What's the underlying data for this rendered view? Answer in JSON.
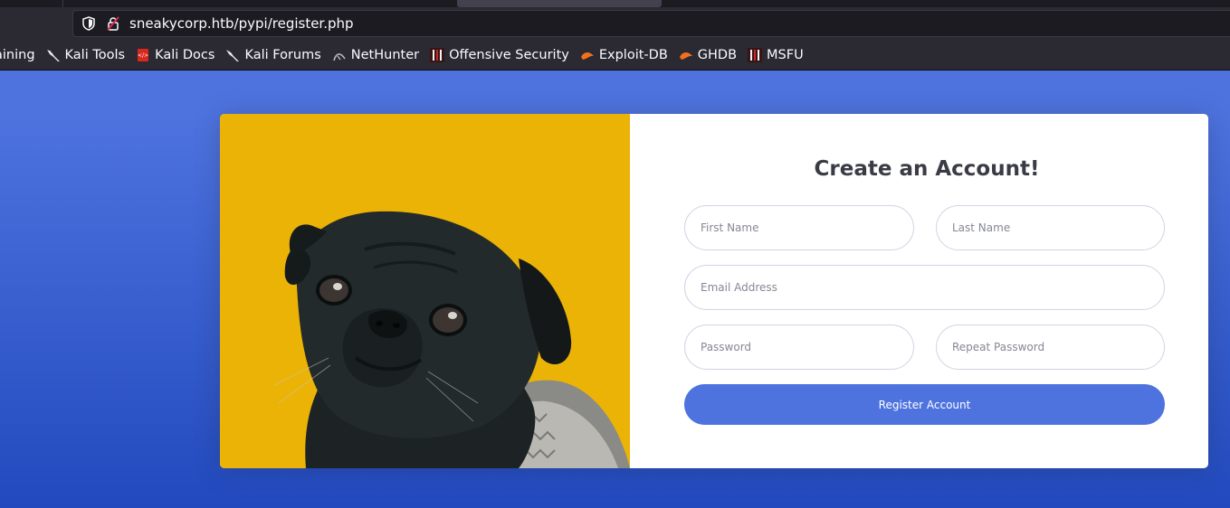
{
  "browser": {
    "url": "sneakycorp.htb/pypi/register.php",
    "bookmarks": [
      {
        "label": "aining",
        "icon": "kali-dragon-icon"
      },
      {
        "label": "Kali Tools",
        "icon": "kali-dragon-icon"
      },
      {
        "label": "Kali Docs",
        "icon": "kali-docs-icon"
      },
      {
        "label": "Kali Forums",
        "icon": "kali-dragon-icon"
      },
      {
        "label": "NetHunter",
        "icon": "nethunter-icon"
      },
      {
        "label": "Offensive Security",
        "icon": "offsec-icon"
      },
      {
        "label": "Exploit-DB",
        "icon": "exploitdb-icon"
      },
      {
        "label": "GHDB",
        "icon": "exploitdb-icon"
      },
      {
        "label": "MSFU",
        "icon": "offsec-icon"
      }
    ]
  },
  "register": {
    "title": "Create an Account!",
    "first_name_placeholder": "First Name",
    "last_name_placeholder": "Last Name",
    "email_placeholder": "Email Address",
    "password_placeholder": "Password",
    "repeat_password_placeholder": "Repeat Password",
    "submit_label": "Register Account"
  },
  "colors": {
    "page_gradient_top": "#4e73df",
    "page_gradient_bottom": "#224abe",
    "button": "#4e73df",
    "photo_background": "#ebb306"
  }
}
